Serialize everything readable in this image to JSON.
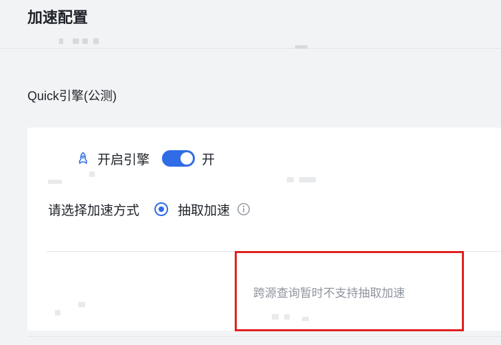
{
  "page": {
    "title": "加速配置"
  },
  "section": {
    "title": "Quick引擎(公测)"
  },
  "engine": {
    "label": "开启引擎",
    "toggle_on": true,
    "toggle_text": "开"
  },
  "mode": {
    "label": "请选择加速方式",
    "option_label": "抽取加速",
    "selected": true
  },
  "notice": {
    "text": "跨源查询暂时不支持抽取加速"
  },
  "colors": {
    "accent": "#2f6ce6",
    "highlight_border": "#e02020",
    "muted_text": "#8f959e"
  },
  "icons": {
    "engine": "rocket-icon",
    "info": "info-icon"
  }
}
